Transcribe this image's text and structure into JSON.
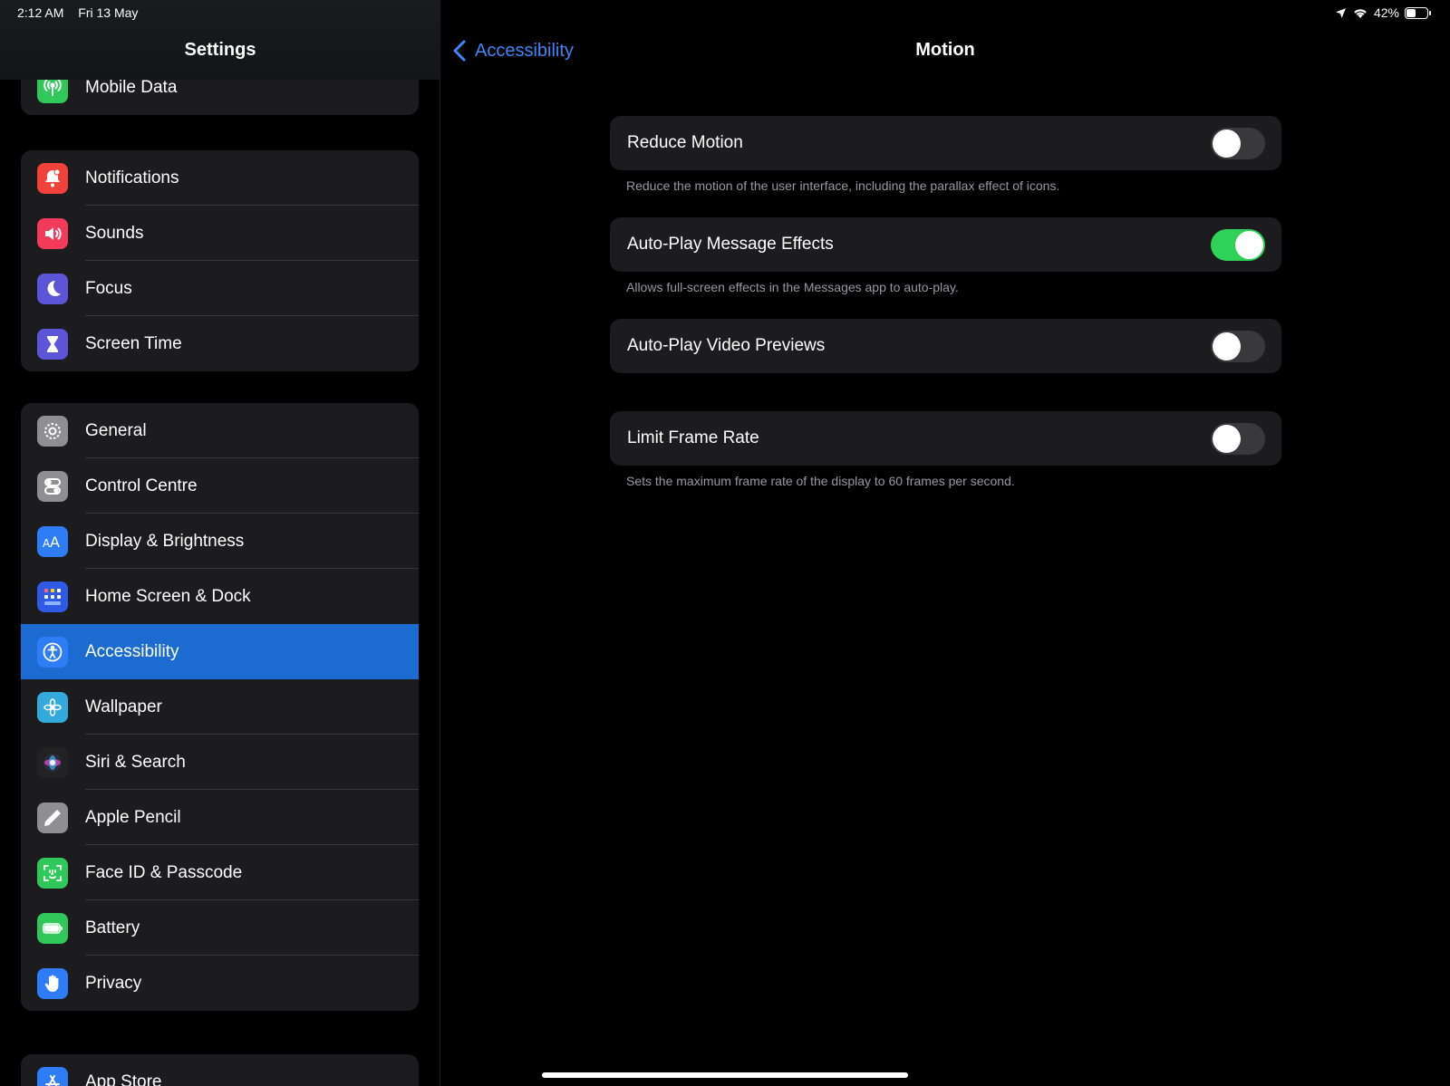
{
  "status": {
    "time": "2:12 AM",
    "date": "Fri 13 May",
    "battery": "42%",
    "battery_level": 0.42
  },
  "sidebar": {
    "title": "Settings",
    "groups": [
      {
        "items": [
          {
            "label": "Mobile Data",
            "icon": "antenna-icon",
            "color": "#30c85a"
          }
        ]
      },
      {
        "items": [
          {
            "label": "Notifications",
            "icon": "bell-icon",
            "color": "#f0413a"
          },
          {
            "label": "Sounds",
            "icon": "speaker-icon",
            "color": "#f23a5a"
          },
          {
            "label": "Focus",
            "icon": "moon-icon",
            "color": "#5d55d8"
          },
          {
            "label": "Screen Time",
            "icon": "hourglass-icon",
            "color": "#5d55d8"
          }
        ]
      },
      {
        "items": [
          {
            "label": "General",
            "icon": "gear-icon",
            "color": "#8e8e93"
          },
          {
            "label": "Control Centre",
            "icon": "switches-icon",
            "color": "#8e8e93"
          },
          {
            "label": "Display & Brightness",
            "icon": "text-size-icon",
            "color": "#2f7df6"
          },
          {
            "label": "Home Screen & Dock",
            "icon": "app-grid-icon",
            "color": "#2f5ae6"
          },
          {
            "label": "Accessibility",
            "icon": "accessibility-icon",
            "color": "#2f7df6",
            "active": true
          },
          {
            "label": "Wallpaper",
            "icon": "flower-icon",
            "color": "#34aadc"
          },
          {
            "label": "Siri & Search",
            "icon": "siri-icon",
            "color": "#222"
          },
          {
            "label": "Apple Pencil",
            "icon": "pencil-icon",
            "color": "#8e8e93"
          },
          {
            "label": "Face ID & Passcode",
            "icon": "face-id-icon",
            "color": "#30c85a"
          },
          {
            "label": "Battery",
            "icon": "battery-icon",
            "color": "#30c85a"
          },
          {
            "label": "Privacy",
            "icon": "hand-icon",
            "color": "#2f7df6"
          }
        ]
      },
      {
        "items": [
          {
            "label": "App Store",
            "icon": "app-store-icon",
            "color": "#2f7df6"
          }
        ]
      }
    ]
  },
  "detail": {
    "back_label": "Accessibility",
    "title": "Motion",
    "settings": [
      {
        "label": "Reduce Motion",
        "on": false,
        "note": "Reduce the motion of the user interface, including the parallax effect of icons."
      },
      {
        "label": "Auto-Play Message Effects",
        "on": true,
        "note": "Allows full-screen effects in the Messages app to auto-play."
      },
      {
        "label": "Auto-Play Video Previews",
        "on": false,
        "note": ""
      },
      {
        "label": "Limit Frame Rate",
        "on": false,
        "note": "Sets the maximum frame rate of the display to 60 frames per second."
      }
    ]
  }
}
